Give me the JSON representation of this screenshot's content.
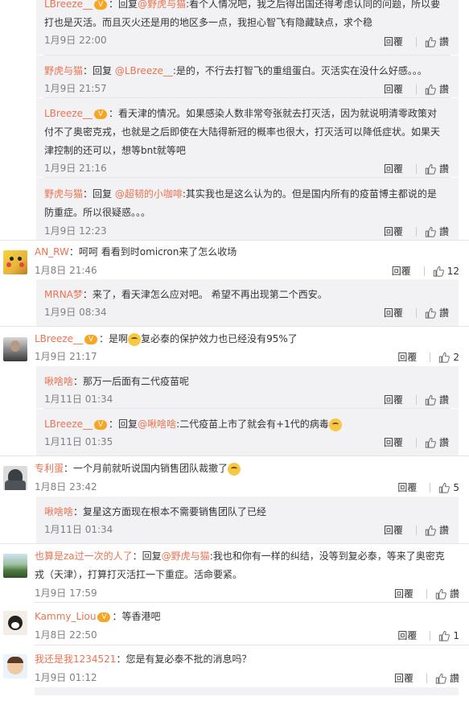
{
  "icons": {
    "like": "thumb-up-icon",
    "vip": "vip-badge-icon",
    "emoji": "emoji-icon"
  },
  "colors": {
    "username": "#eb7350",
    "text": "#333333",
    "date": "#808080",
    "reply_bg": "#f2f2f5"
  },
  "ui": {
    "reply_label": "回覆",
    "like_label": "讚"
  },
  "thread1": {
    "top_reply": {
      "user": "LBreeze__",
      "prefix": "：回复",
      "at": "@野虎与猫",
      "text1": ":看个人情况吧，我之后得出国还得考虑认同的问题，所以要",
      "text2": "打也是灭活。而且灭火还是用的地区多一点，我担心智飞有隐藏缺点，求个稳",
      "date": "1月9日 22:00"
    },
    "r2": {
      "user": "野虎与猫",
      "prefix": "：回复 ",
      "at": "@LBreeze__",
      "text": ":是的，不行去打智飞的重组蛋白。灭活实在没什么好感。。。",
      "date": "1月9日 21:57"
    },
    "r3": {
      "user": "LBreeze__",
      "text1": "：看天津的情况。如果感染人数非常夸张就去打灭活，因为就说明清零政策对",
      "text2": "付不了奥密克戎，也就是之后即使在大陆得新冠的概率也很大，打灭活可以降低症状。如果天",
      "text3": "津控制的还可以，想等bnt就等吧",
      "date": "1月9日 21:16"
    },
    "r4": {
      "user": "野虎与猫",
      "prefix": "：回复 ",
      "at": "@超韧的小咖啡",
      "text1": ":其实我也是这么认为的。但是国内所有的疫苗博主都说的是",
      "text2": "防重症。所以很疑惑。。。",
      "date": "1月9日 12:23"
    }
  },
  "comments": [
    {
      "user": "AN_RW",
      "text": "：呵呵 看看到时omicron来了怎么收场",
      "date": "1月8日 21:46",
      "likes": "12",
      "replies": [
        {
          "user": "MRNA梦",
          "text": "：来了，看天津怎么应对吧。 希望不再出现第二个西安。",
          "date": "1月9日 08:34"
        }
      ]
    },
    {
      "user": "LBreeze__",
      "text1": "：是啊",
      "text2": "复必泰的保护效力也已经没有95%了",
      "date": "1月9日 21:17",
      "likes": "2",
      "replies": [
        {
          "user": "啾啥啥",
          "text": "：那万一后面有二代疫苗呢",
          "date": "1月11日 01:34"
        },
        {
          "user": "LBreeze__",
          "prefix": "：回复",
          "at": "@啾啥啥",
          "text": ":二代疫苗上市了就会有+1代的病毒",
          "date": "1月11日 01:35"
        }
      ]
    },
    {
      "user": "专利蛋",
      "text": "：一个月前就听说国内销售团队裁撤了",
      "date": "1月8日 23:42",
      "likes": "5",
      "replies": [
        {
          "user": "啾啥啥",
          "text": "：复星这方面现在根本不需要销售团队了已经",
          "date": "1月11日 01:34"
        }
      ]
    },
    {
      "user": "也算是za过一次的人了",
      "prefix": "：回复",
      "at": "@野虎与猫",
      "text1": ":我也和你有一样的纠结，没等到复必泰，等来了奥密克",
      "text2": "戎（天津），打算打灭活扛一下重症。活命要紧。",
      "date": "1月9日 17:59",
      "likes": "讚"
    },
    {
      "user": "Kammy_Liou",
      "text": "：等香港吧",
      "date": "1月8日 22:50",
      "likes": "1"
    },
    {
      "user": "我还是我1234521",
      "text": "：您是有复必泰不批的消息吗？",
      "date": "1月9日 01:12",
      "likes": "讚"
    }
  ]
}
